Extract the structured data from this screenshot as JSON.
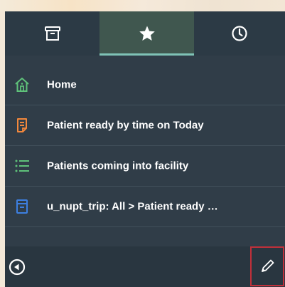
{
  "tabs": [
    {
      "icon": "archive-icon"
    },
    {
      "icon": "star-icon",
      "active": true
    },
    {
      "icon": "clock-icon"
    }
  ],
  "favorites": [
    {
      "label": "Home",
      "icon": "home-icon",
      "color": "#5fc27a"
    },
    {
      "label": "Patient ready by time on Today",
      "icon": "report-icon",
      "color": "#f2883c"
    },
    {
      "label": "Patients coming into facility",
      "icon": "list-icon",
      "color": "#5fc27a"
    },
    {
      "label": "u_nupt_trip: All > Patient ready …",
      "icon": "form-icon",
      "color": "#3d7fe0"
    }
  ],
  "footer": {
    "back_icon": "circle-left-icon",
    "edit_icon": "pencil-icon"
  },
  "colors": {
    "panel": "#303d48",
    "active_tab": "#40574f",
    "active_underline": "#7fc3b6",
    "edit_highlight": "#c0303a"
  }
}
